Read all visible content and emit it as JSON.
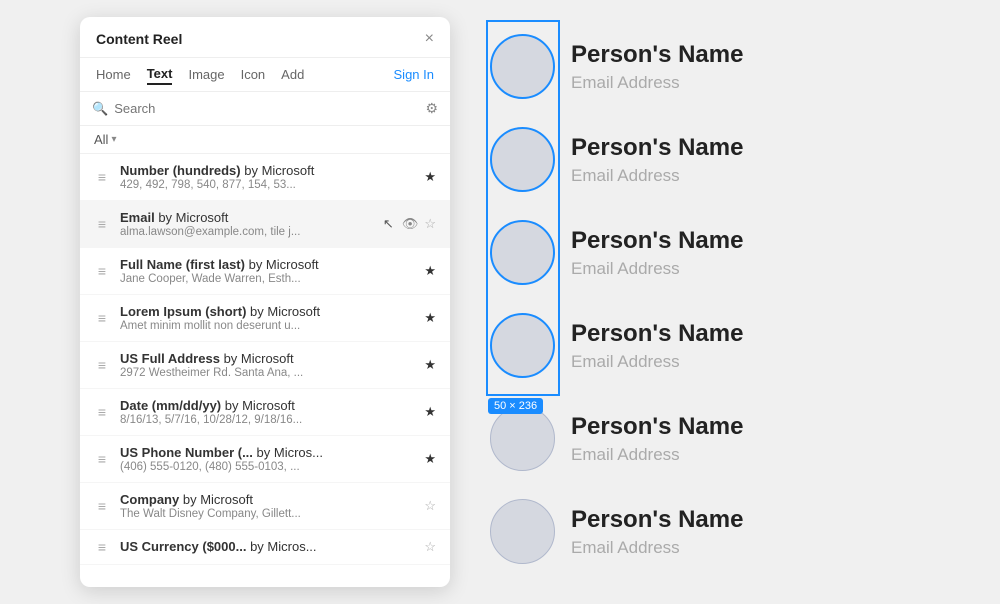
{
  "panel": {
    "title": "Content Reel",
    "close_label": "×",
    "nav": {
      "tabs": [
        {
          "label": "Home",
          "active": false
        },
        {
          "label": "Text",
          "active": true
        },
        {
          "label": "Image",
          "active": false
        },
        {
          "label": "Icon",
          "active": false
        },
        {
          "label": "Add",
          "active": false
        }
      ],
      "sign_in_label": "Sign In"
    },
    "search": {
      "placeholder": "Search"
    },
    "filter": {
      "label": "All"
    },
    "items": [
      {
        "name": "Number (hundreds)",
        "by": "by Microsoft",
        "preview": "429, 492, 798, 540, 877, 154, 53...",
        "starred": true,
        "active": false
      },
      {
        "name": "Email",
        "by": "by Microsoft",
        "preview": "alma.lawson@example.com, tile j...",
        "starred": false,
        "active": true,
        "eye": true,
        "cursor": true
      },
      {
        "name": "Full Name (first last)",
        "by": "by Microsoft",
        "preview": "Jane Cooper, Wade Warren, Esth...",
        "starred": true,
        "active": false
      },
      {
        "name": "Lorem Ipsum (short)",
        "by": "by Microsoft",
        "preview": "Amet minim mollit non deserunt u...",
        "starred": true,
        "active": false
      },
      {
        "name": "US Full Address",
        "by": "by Microsoft",
        "preview": "2972 Westheimer Rd. Santa Ana, ...",
        "starred": true,
        "active": false
      },
      {
        "name": "Date (mm/dd/yy)",
        "by": "by Microsoft",
        "preview": "8/16/13, 5/7/16, 10/28/12, 9/18/16...",
        "starred": true,
        "active": false
      },
      {
        "name": "US Phone Number (...",
        "by": "by Micros...",
        "preview": "(406) 555-0120, (480) 555-0103, ...",
        "starred": true,
        "active": false
      },
      {
        "name": "Company",
        "by": "by Microsoft",
        "preview": "The Walt Disney Company, Gillett...",
        "starred": false,
        "active": false
      },
      {
        "name": "US Currency ($000...",
        "by": "by Micros...",
        "preview": "",
        "starred": false,
        "active": false
      }
    ]
  },
  "canvas": {
    "cards": [
      {
        "name": "Person's Name",
        "email": "Email Address",
        "selected": true
      },
      {
        "name": "Person's Name",
        "email": "Email Address",
        "selected": true
      },
      {
        "name": "Person's Name",
        "email": "Email Address",
        "selected": true
      },
      {
        "name": "Person's Name",
        "email": "Email Address",
        "selected": true
      },
      {
        "name": "Person's Name",
        "email": "Email Address",
        "selected": false
      },
      {
        "name": "Person's Name",
        "email": "Email Address",
        "selected": false
      }
    ],
    "dimension_badge": "50 × 236"
  }
}
